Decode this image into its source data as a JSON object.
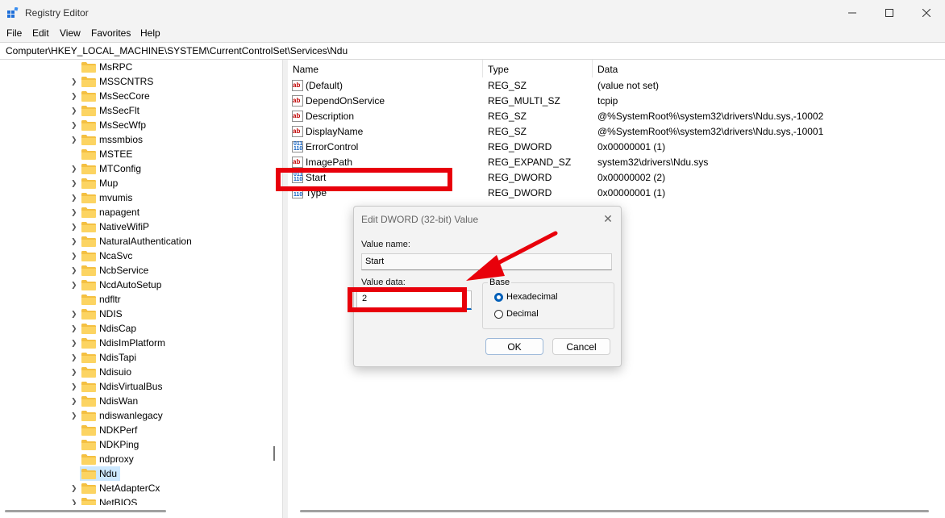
{
  "window": {
    "title": "Registry Editor"
  },
  "menu": [
    "File",
    "Edit",
    "View",
    "Favorites",
    "Help"
  ],
  "address": "Computer\\HKEY_LOCAL_MACHINE\\SYSTEM\\CurrentControlSet\\Services\\Ndu",
  "tree": {
    "items": [
      {
        "label": "MsRPC",
        "expandable": false
      },
      {
        "label": "MSSCNTRS",
        "expandable": true
      },
      {
        "label": "MsSecCore",
        "expandable": true
      },
      {
        "label": "MsSecFlt",
        "expandable": true
      },
      {
        "label": "MsSecWfp",
        "expandable": true
      },
      {
        "label": "mssmbios",
        "expandable": true
      },
      {
        "label": "MSTEE",
        "expandable": false
      },
      {
        "label": "MTConfig",
        "expandable": true
      },
      {
        "label": "Mup",
        "expandable": true
      },
      {
        "label": "mvumis",
        "expandable": true
      },
      {
        "label": "napagent",
        "expandable": true
      },
      {
        "label": "NativeWifiP",
        "expandable": true
      },
      {
        "label": "NaturalAuthentication",
        "expandable": true
      },
      {
        "label": "NcaSvc",
        "expandable": true
      },
      {
        "label": "NcbService",
        "expandable": true
      },
      {
        "label": "NcdAutoSetup",
        "expandable": true
      },
      {
        "label": "ndfltr",
        "expandable": false
      },
      {
        "label": "NDIS",
        "expandable": true
      },
      {
        "label": "NdisCap",
        "expandable": true
      },
      {
        "label": "NdisImPlatform",
        "expandable": true
      },
      {
        "label": "NdisTapi",
        "expandable": true
      },
      {
        "label": "Ndisuio",
        "expandable": true
      },
      {
        "label": "NdisVirtualBus",
        "expandable": true
      },
      {
        "label": "NdisWan",
        "expandable": true
      },
      {
        "label": "ndiswanlegacy",
        "expandable": true
      },
      {
        "label": "NDKPerf",
        "expandable": false
      },
      {
        "label": "NDKPing",
        "expandable": false
      },
      {
        "label": "ndproxy",
        "expandable": false
      },
      {
        "label": "Ndu",
        "expandable": false,
        "selected": true
      },
      {
        "label": "NetAdapterCx",
        "expandable": true
      },
      {
        "label": "NetBIOS",
        "expandable": true
      }
    ]
  },
  "columns": {
    "name": "Name",
    "type": "Type",
    "data": "Data"
  },
  "values": [
    {
      "name": "(Default)",
      "type": "REG_SZ",
      "data": "(value not set)",
      "icon": "string-value-icon"
    },
    {
      "name": "DependOnService",
      "type": "REG_MULTI_SZ",
      "data": "tcpip",
      "icon": "string-value-icon"
    },
    {
      "name": "Description",
      "type": "REG_SZ",
      "data": "@%SystemRoot%\\system32\\drivers\\Ndu.sys,-10002",
      "icon": "string-value-icon"
    },
    {
      "name": "DisplayName",
      "type": "REG_SZ",
      "data": "@%SystemRoot%\\system32\\drivers\\Ndu.sys,-10001",
      "icon": "string-value-icon"
    },
    {
      "name": "ErrorControl",
      "type": "REG_DWORD",
      "data": "0x00000001 (1)",
      "icon": "binary-value-icon"
    },
    {
      "name": "ImagePath",
      "type": "REG_EXPAND_SZ",
      "data": "system32\\drivers\\Ndu.sys",
      "icon": "string-value-icon"
    },
    {
      "name": "Start",
      "type": "REG_DWORD",
      "data": "0x00000002 (2)",
      "icon": "binary-value-icon"
    },
    {
      "name": "Type",
      "type": "REG_DWORD",
      "data": "0x00000001 (1)",
      "icon": "binary-value-icon"
    }
  ],
  "dialog": {
    "title": "Edit DWORD (32-bit) Value",
    "value_name_label": "Value name:",
    "value_name": "Start",
    "value_data_label": "Value data:",
    "value_data": "2",
    "base_label": "Base",
    "hex_label": "Hexadecimal",
    "dec_label": "Decimal",
    "selected_base": "Hexadecimal",
    "ok_label": "OK",
    "cancel_label": "Cancel"
  },
  "annotation_color": "#e8000b",
  "accent": "#005fb8"
}
